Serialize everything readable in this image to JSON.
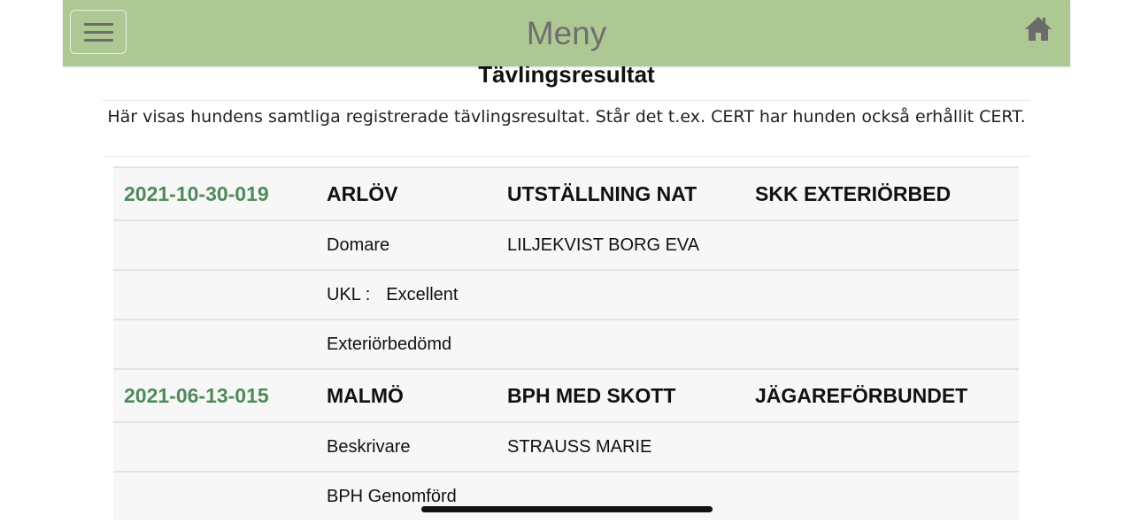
{
  "header": {
    "title": "Meny",
    "menu_icon": "hamburger-menu-icon",
    "home_icon": "home-icon",
    "background_color": "#adc893"
  },
  "section": {
    "title": "Tävlingsresultat",
    "intro": "Här visas hundens samtliga registrerade tävlingsresultat. Står det t.ex. CERT har hunden också erhållit CERT."
  },
  "results": [
    {
      "date": "2021-10-30-019",
      "place": "ARLÖV",
      "event": "UTSTÄLLNING NAT",
      "organizer": "SKK EXTERIÖRBED",
      "details": [
        {
          "label": "Domare",
          "value": "LILJEKVIST BORG EVA"
        },
        {
          "label": "UKL :",
          "value": "Excellent"
        },
        {
          "label": "Exteriörbedömd",
          "value": ""
        }
      ]
    },
    {
      "date": "2021-06-13-015",
      "place": "MALMÖ",
      "event": "BPH MED SKOTT",
      "organizer": "JÄGAREFÖRBUNDET",
      "details": [
        {
          "label": "Beskrivare",
          "value": "STRAUSS MARIE"
        },
        {
          "label": "BPH Genomförd",
          "value": ""
        }
      ]
    }
  ],
  "colors": {
    "date_green": "#4f8a5b",
    "row_background": "#f7f7f7"
  }
}
